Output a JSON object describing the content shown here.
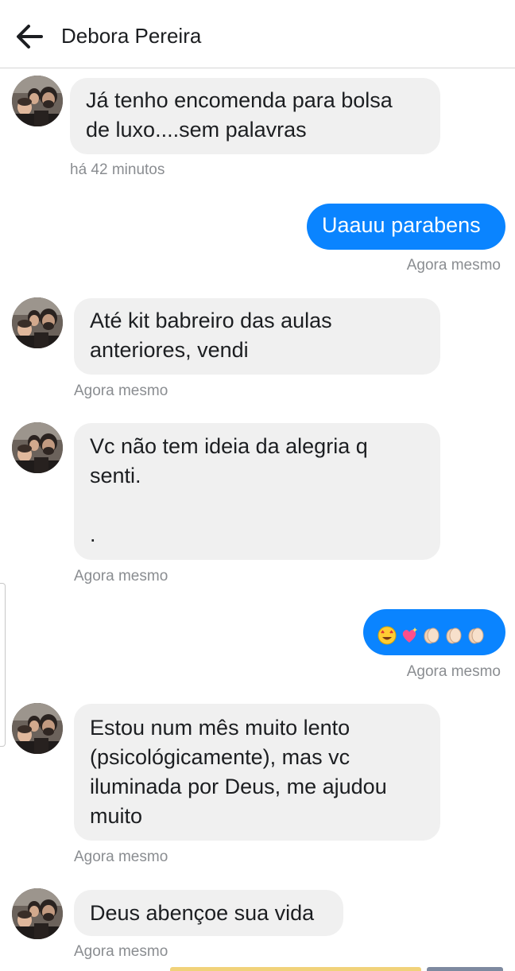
{
  "header": {
    "contact_name": "Debora Pereira",
    "back_icon": "arrow-left-icon"
  },
  "colors": {
    "outgoing_bubble": "#0a84ff",
    "incoming_bubble": "#f0f0f0",
    "timestamp": "#8a8d91"
  },
  "messages": [
    {
      "direction": "incoming",
      "lines": [
        "Já tenho encomenda para bolsa",
        "de luxo....sem palavras"
      ],
      "time": "há 42 minutos"
    },
    {
      "direction": "outgoing",
      "lines": [
        "Uaauu parabens"
      ],
      "time": "Agora mesmo"
    },
    {
      "direction": "incoming",
      "lines": [
        "Até kit babreiro das aulas",
        "anteriores, vendi"
      ],
      "time": "Agora mesmo"
    },
    {
      "direction": "incoming",
      "lines": [
        "Vc não tem ideia da alegria q",
        "senti.",
        "",
        "."
      ],
      "time": "Agora mesmo"
    },
    {
      "direction": "outgoing",
      "emojis": [
        "star-struck-emoji",
        "sparkling-heart-emoji",
        "clapping-hands-emoji",
        "clapping-hands-emoji",
        "clapping-hands-emoji"
      ],
      "time": "Agora mesmo"
    },
    {
      "direction": "incoming",
      "lines": [
        "Estou num mês muito lento",
        "(psicológicamente), mas vc",
        "iluminada por Deus, me ajudou",
        "muito"
      ],
      "time": "Agora mesmo"
    },
    {
      "direction": "incoming",
      "lines": [
        "Deus abençoe sua vida"
      ],
      "time": "Agora mesmo"
    }
  ]
}
